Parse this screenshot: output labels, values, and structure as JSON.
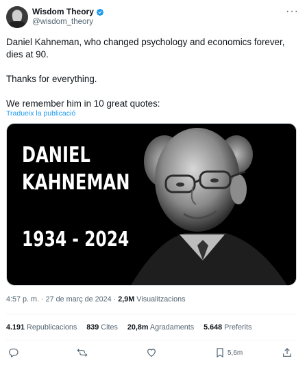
{
  "author": {
    "display_name": "Wisdom Theory",
    "handle": "@wisdom_theory",
    "verified_icon": "verified-badge-icon"
  },
  "post": {
    "line1": "Daniel Kahneman, who changed psychology and economics forever,",
    "line2": "dies at 90.",
    "line3": "Thanks for everything.",
    "line4": "We remember him in 10 great quotes:",
    "translate_label": "Tradueix la publicació"
  },
  "media": {
    "name_first": "DANIEL",
    "name_last": "KAHNEMAN",
    "years": "1934 - 2024"
  },
  "meta": {
    "time": "4:57 p. m.",
    "separator": "·",
    "date": "27 de març de 2024",
    "views_count": "2,9M",
    "views_label": "Visualitzacions"
  },
  "stats": {
    "reposts_count": "4.191",
    "reposts_label": "Republicacions",
    "quotes_count": "839",
    "quotes_label": "Cites",
    "likes_count": "20,8m",
    "likes_label": "Agradaments",
    "bookmarks_count": "5.648",
    "bookmarks_label": "Preferits"
  },
  "actions": {
    "bookmark_count": "5,6m"
  },
  "colors": {
    "accent": "#1d9bf0",
    "secondary_text": "#536471",
    "divider": "#eff3f4"
  }
}
